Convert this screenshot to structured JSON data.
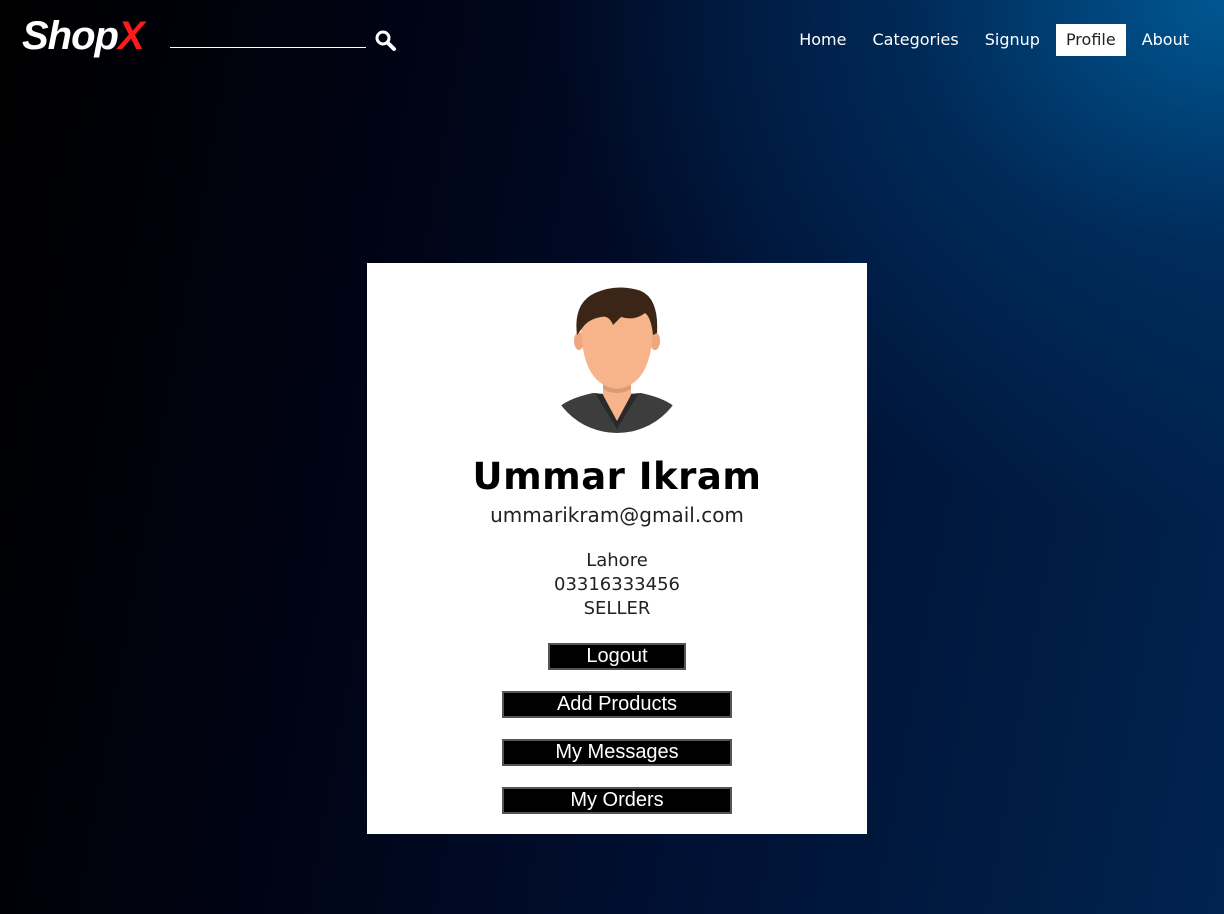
{
  "nav": {
    "logo_main": "Shop",
    "logo_accent": "X",
    "search_placeholder": "",
    "links": [
      {
        "label": "Home"
      },
      {
        "label": "Categories"
      },
      {
        "label": "Signup"
      },
      {
        "label": "Profile"
      },
      {
        "label": "About"
      }
    ],
    "active_link": "Profile"
  },
  "profile": {
    "name": "Ummar Ikram",
    "email": "ummarikram@gmail.com",
    "city": "Lahore",
    "phone": "03316333456",
    "role": "SELLER"
  },
  "actions": {
    "logout": "Logout",
    "add_products": "Add Products",
    "my_messages": "My Messages",
    "my_orders": "My Orders"
  },
  "colors": {
    "logo_accent": "#ff1a1a",
    "card_bg": "#ffffff",
    "button_bg": "#000000"
  }
}
